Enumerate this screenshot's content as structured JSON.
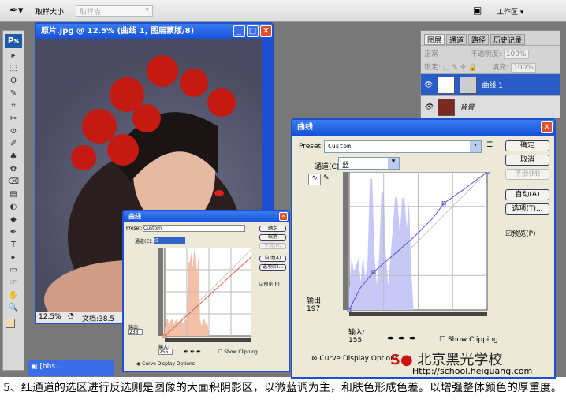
{
  "options_bar": {
    "sample_size_label": "取样大小:",
    "sample_size_value": "取样点",
    "workspace_label": "工作区 ▾"
  },
  "toolbox": {
    "logo": "Ps",
    "tools": [
      "▸",
      "⬚",
      "ʘ",
      "✎",
      "⌗",
      "✂",
      "⊘",
      "✐",
      "♣",
      "✿",
      "⌫",
      "▤",
      "◐",
      "◆",
      "✒",
      "T",
      "▸",
      "▭",
      "☞",
      "✋",
      "🔍"
    ]
  },
  "document": {
    "title": "原片.jpg @ 12.5% (曲线 1, 图层蒙版/8)",
    "zoom": "12.5%",
    "doc_info": "文档:38.5"
  },
  "minimized_window": {
    "title": "[bbs..."
  },
  "layers_panel": {
    "tabs": [
      "图层",
      "通道",
      "路径",
      "历史记录"
    ],
    "blend_mode": "正常",
    "opacity_label": "不透明度:",
    "opacity": "100%",
    "lock_label": "锁定:",
    "fill_label": "填充:",
    "fill": "100%",
    "layers": [
      {
        "name": "曲线 1",
        "selected": true
      },
      {
        "name": "背景",
        "selected": false
      }
    ]
  },
  "curves_large": {
    "title": "曲线",
    "preset_label": "Preset:",
    "preset": "Custom",
    "channel_label": "通道(C):",
    "channel": "蓝",
    "buttons": [
      "确定",
      "取消",
      "平滑(M)",
      "自动(A)",
      "选项(T)..."
    ],
    "preview_label": "预览(P)",
    "output_label": "输出:",
    "output": "197",
    "input_label": "输入:",
    "input": "155",
    "show_clipping": "Show Clipping",
    "display_options": "Curve Display Options",
    "curve_color": "#5a50e0",
    "histogram_color": "#c8c8f8"
  },
  "curves_small": {
    "title": "曲线",
    "preset_label": "Preset:",
    "preset": "Custom",
    "channel_label": "通道(C):",
    "channel": "红",
    "buttons": [
      "确定",
      "取消",
      "平滑(M)",
      "自动(A)",
      "选项(T)..."
    ],
    "preview_label": "预览(P)",
    "output_label": "输出:",
    "output": "233",
    "input_label": "输入:",
    "input": "255",
    "show_clipping": "Show Clipping",
    "display_options": "Curve Display Options",
    "curve_color": "#e0604a",
    "histogram_color": "#f5c0a8"
  },
  "watermark": {
    "name": "北京黑光学校",
    "url": "Http://school.heiguang.com"
  },
  "caption": "5、红通道的选区进行反选则是图像的大面积阴影区，以微蓝调为主，和肤色形成色差。以增强整体颜色的厚重度。"
}
